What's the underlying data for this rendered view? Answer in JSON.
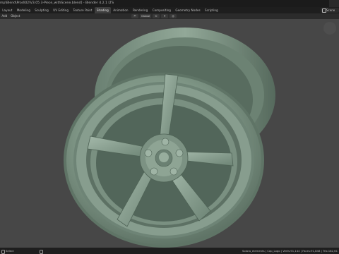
{
  "window": {
    "title": "mp\\Blend\\Prod\\02\\V3.05 3-Piece_withScene.blend] - Blender 4.2.1 LTS"
  },
  "workspace_tabs": [
    {
      "label": "Layout",
      "active": false
    },
    {
      "label": "Modeling",
      "active": false
    },
    {
      "label": "Sculpting",
      "active": false
    },
    {
      "label": "UV Editing",
      "active": false
    },
    {
      "label": "Texture Paint",
      "active": false
    },
    {
      "label": "Shading",
      "active": true
    },
    {
      "label": "Animation",
      "active": false
    },
    {
      "label": "Rendering",
      "active": false
    },
    {
      "label": "Compositing",
      "active": false
    },
    {
      "label": "Geometry Nodes",
      "active": false
    },
    {
      "label": "Scripting",
      "active": false
    }
  ],
  "scene_selector": {
    "label": "Scene"
  },
  "viewport_header": {
    "menu": [
      "Add",
      "Object"
    ],
    "transform_orientation": "Global"
  },
  "statusbar": {
    "left_action": "Select",
    "right_stats": "Solara_elements | Cap_Logo | Verts:91,144 | Faces:91,848 | Tris:182,61"
  },
  "colors": {
    "rim_base": "#7e9585",
    "rim_light": "#9ab1a0",
    "rim_dark": "#4f6356",
    "viewport_bg": "#474747"
  }
}
